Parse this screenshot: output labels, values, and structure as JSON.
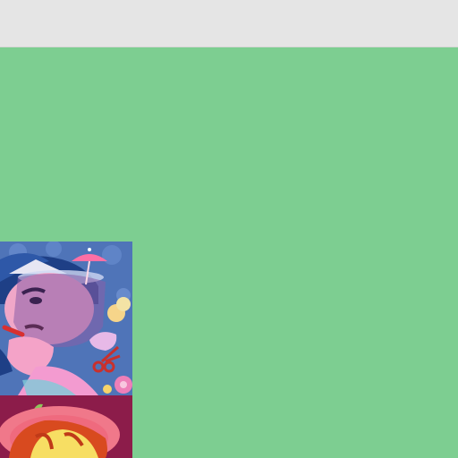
{
  "app": {
    "topbar_color": "#e5e5e5",
    "canvas_color": "#7dce91"
  },
  "gallery": {
    "items": [
      {
        "icon": "illustration-person-with-umbrella-drink-icon",
        "accent": "#4f6fb5"
      },
      {
        "icon": "illustration-person-with-red-hat-icon",
        "accent": "#8c1c4a"
      }
    ]
  }
}
